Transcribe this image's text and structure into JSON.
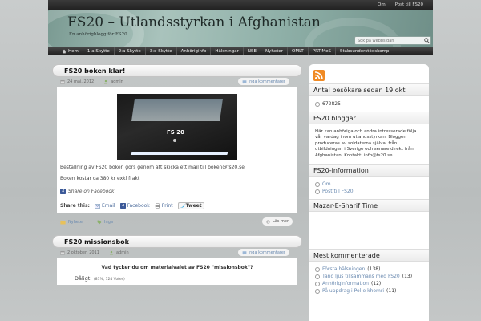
{
  "topbar": {
    "links": [
      "Om",
      "Post till FS20"
    ]
  },
  "header": {
    "title": "FS20 – Utlandsstyrkan i Afghanistan",
    "description": "En anhörigblogg för FS20",
    "search_placeholder": "Sök på webbsidan"
  },
  "nav": {
    "items": [
      "Hem",
      "1:a Skytte",
      "2:a Skytte",
      "3:e Skytte",
      "Anhöriginfo",
      "Hälsningar",
      "NSE",
      "Nyheter",
      "OMLT",
      "PRT-MeS",
      "Stabsunderstödskomp"
    ]
  },
  "post1": {
    "title": "FS20 boken klar!",
    "date": "24 maj, 2012",
    "author": "admin",
    "comments": "Inga kommentarer",
    "book_label": "FS 20",
    "para1": "Beställning av FS20 boken görs genom att skicka ett mail till boken@fs20.se",
    "para2": "Boken kostar ca 380 kr exkl frakt",
    "fb_share": "Share on Facebook",
    "share_label": "Share this:",
    "share_email": "Email",
    "share_facebook": "Facebook",
    "share_print": "Print",
    "share_tweet": "Tweet",
    "category": "Nyheter",
    "tags": "Inga",
    "more": "Läs mer"
  },
  "post2": {
    "title": "FS20 missionsbok",
    "date": "2 oktober, 2011",
    "author": "admin",
    "comments": "Inga kommentarer",
    "poll_question": "Vad tycker du om materialvalet av FS20 \"missionsbok\"?",
    "poll_answer": "Dåligt!",
    "poll_stats": "(81%, 124 Votes)"
  },
  "sidebar": {
    "visitors_title": "Antal besökare sedan 19 okt",
    "visitors_count": "672825",
    "blog_title": "FS20 bloggar",
    "blog_text": "Här kan anhöriga och andra intresserade följa vår vardag inom utlandsstyrkan. Bloggen produceras av soldaterna själva, från utbildningen i Sverige och senare direkt från Afghanistan. Kontakt: info@fs20.se",
    "info_title": "FS20-information",
    "info_links": [
      "Om",
      "Post till FS20"
    ],
    "mazar_title": "Mazar-E-Sharif Time",
    "most_title": "Mest kommenterade",
    "most_items": [
      {
        "title": "Första hälsningen",
        "count": "(138)"
      },
      {
        "title": "Tänd ljus tillsammans med FS20",
        "count": "(13)"
      },
      {
        "title": "Anhöriginformation",
        "count": "(12)"
      },
      {
        "title": "På uppdrag i Pol-e khomri",
        "count": "(11)"
      }
    ]
  },
  "colors": {
    "accent_link": "#6a8ab0",
    "nav_bg": "#2a2a2a",
    "header_teal": "#8fb0a8"
  }
}
